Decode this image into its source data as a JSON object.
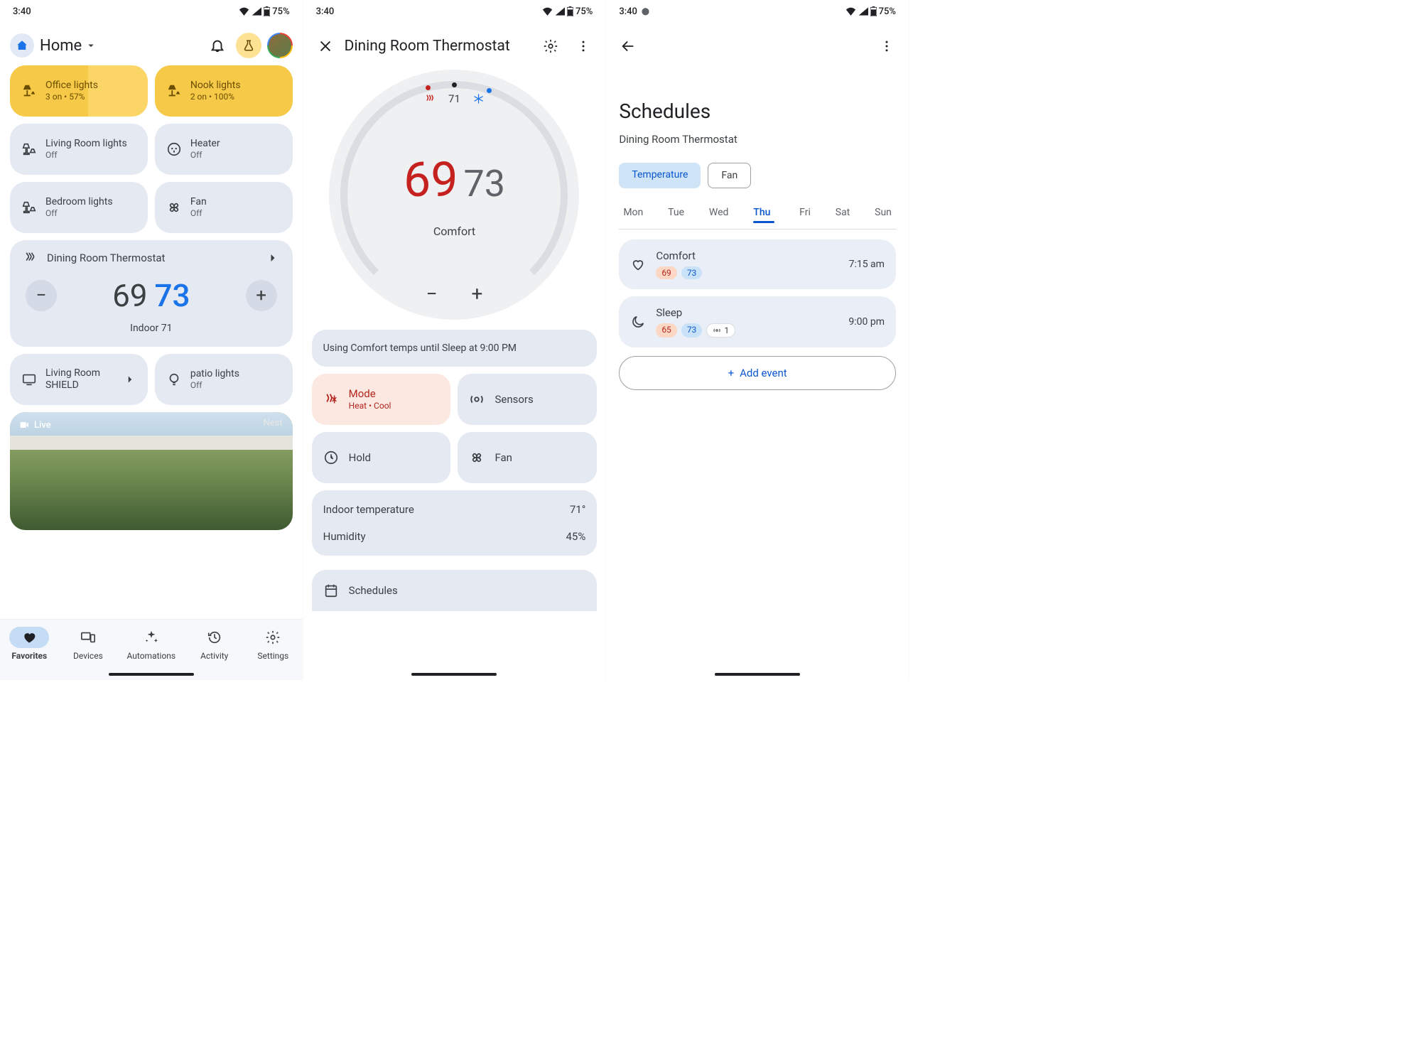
{
  "status": {
    "time": "3:40",
    "battery_pct": "75%"
  },
  "screen1": {
    "home_label": "Home",
    "tiles_on": [
      {
        "name": "Office lights",
        "sub": "3 on • 57%",
        "fill_pct": 57
      },
      {
        "name": "Nook lights",
        "sub": "2 on • 100%",
        "fill_pct": 100
      }
    ],
    "tiles_off": [
      {
        "name": "Living Room lights",
        "sub": "Off"
      },
      {
        "name": "Heater",
        "sub": "Off"
      },
      {
        "name": "Bedroom lights",
        "sub": "Off"
      },
      {
        "name": "Fan",
        "sub": "Off"
      }
    ],
    "thermostat": {
      "title": "Dining Room Thermostat",
      "heat": "69",
      "cool": "73",
      "indoor_label": "Indoor 71"
    },
    "shield_tile": {
      "name": "Living Room SHIELD"
    },
    "patio_tile": {
      "name": "patio lights",
      "sub": "Off"
    },
    "camera": {
      "live": "Live",
      "brand": "Nest"
    },
    "nav": {
      "favorites": "Favorites",
      "devices": "Devices",
      "automations": "Automations",
      "activity": "Activity",
      "settings": "Settings"
    }
  },
  "screen2": {
    "title": "Dining Room Thermostat",
    "dial": {
      "current": "71",
      "heat": "69",
      "cool": "73",
      "mode_label": "Comfort"
    },
    "status_text": "Using Comfort temps until Sleep at 9:00 PM",
    "mode_tile": {
      "label": "Mode",
      "sub": "Heat • Cool"
    },
    "sensors_tile": "Sensors",
    "hold_tile": "Hold",
    "fan_tile": "Fan",
    "info": {
      "indoor_label": "Indoor temperature",
      "indoor_value": "71°",
      "humidity_label": "Humidity",
      "humidity_value": "45%"
    },
    "schedules_label": "Schedules"
  },
  "screen3": {
    "title": "Schedules",
    "subtitle": "Dining Room Thermostat",
    "chips": {
      "temperature": "Temperature",
      "fan": "Fan"
    },
    "days": [
      "Mon",
      "Tue",
      "Wed",
      "Thu",
      "Fri",
      "Sat",
      "Sun"
    ],
    "active_day_index": 3,
    "events": [
      {
        "name": "Comfort",
        "heat": "69",
        "cool": "73",
        "time": "7:15 am",
        "sensor_count": null,
        "icon": "heart"
      },
      {
        "name": "Sleep",
        "heat": "65",
        "cool": "73",
        "time": "9:00 pm",
        "sensor_count": "1",
        "icon": "moon"
      }
    ],
    "add_label": "Add event"
  }
}
